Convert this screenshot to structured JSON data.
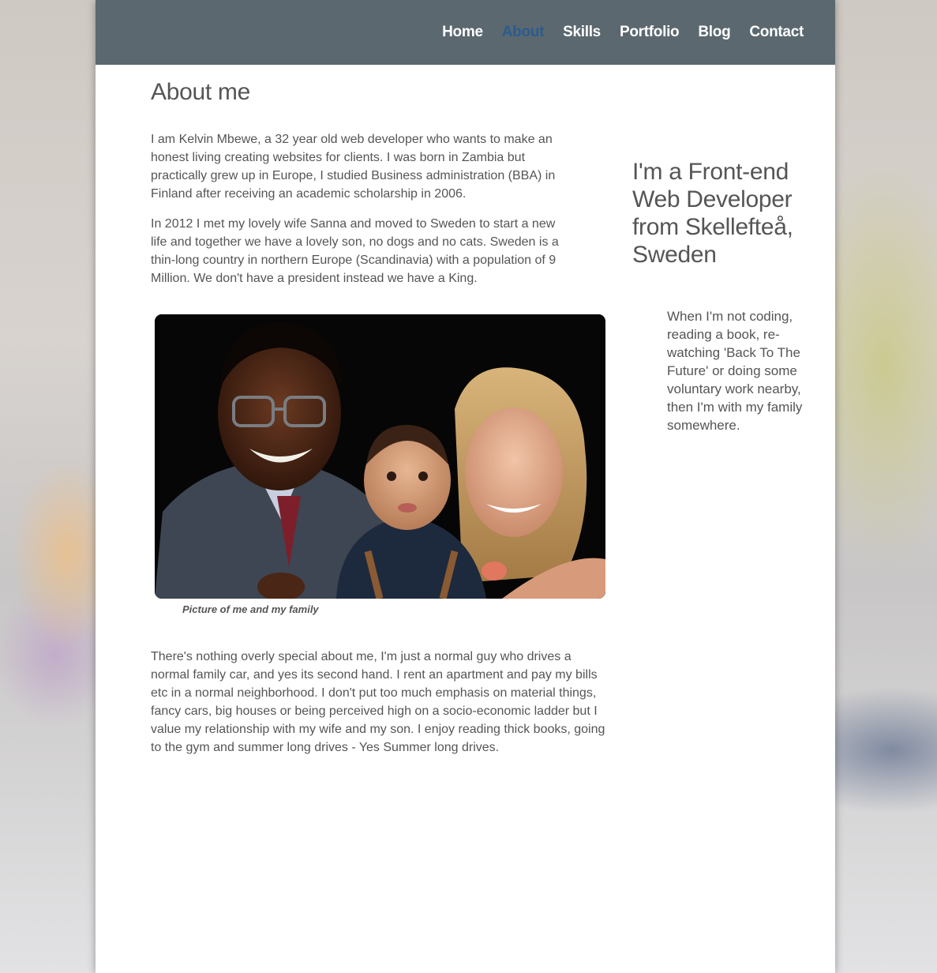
{
  "nav": {
    "items": [
      {
        "label": "Home"
      },
      {
        "label": "About"
      },
      {
        "label": "Skills"
      },
      {
        "label": "Portfolio"
      },
      {
        "label": "Blog"
      },
      {
        "label": "Contact"
      }
    ],
    "active": "About"
  },
  "main": {
    "title": "About me",
    "paragraph1": "I am Kelvin Mbewe, a 32 year old web developer who wants to make an honest living creating websites for clients. I was born in Zambia but practically grew up in Europe, I studied Business administration (BBA) in Finland after receiving an academic scholarship in 2006.",
    "paragraph2": "In 2012 I met my lovely wife Sanna and moved to Sweden to start a new life and together we have a lovely son, no dogs and no cats. Sweden is a thin-long country in northern Europe (Scandinavia) with a population of 9 Million. We don't have a president instead we have a King.",
    "photo_caption": "Picture of me and my family",
    "paragraph3": "There's nothing overly special about me, I'm just a normal guy who drives a normal family car, and yes its second hand. I rent an apartment and pay my bills etc in a normal neighborhood. I don't put too much emphasis on material things, fancy cars, big houses or being perceived high on a socio-economic ladder but I value my relationship with my wife and my son. I enjoy reading thick books, going to the gym and summer long drives - Yes Summer long drives."
  },
  "sidebar": {
    "heading": "I'm a Front-end Web Developer from Skellefteå, Sweden",
    "text": "When I'm not coding, reading a book, re-watching 'Back To The Future' or doing some voluntary work nearby, then I'm with my family somewhere."
  },
  "colors": {
    "header_bg": "#5b6870",
    "nav_text": "#ffffff",
    "nav_active": "#2b5b8f",
    "body_text": "#555555",
    "page_bg": "#ffffff"
  }
}
